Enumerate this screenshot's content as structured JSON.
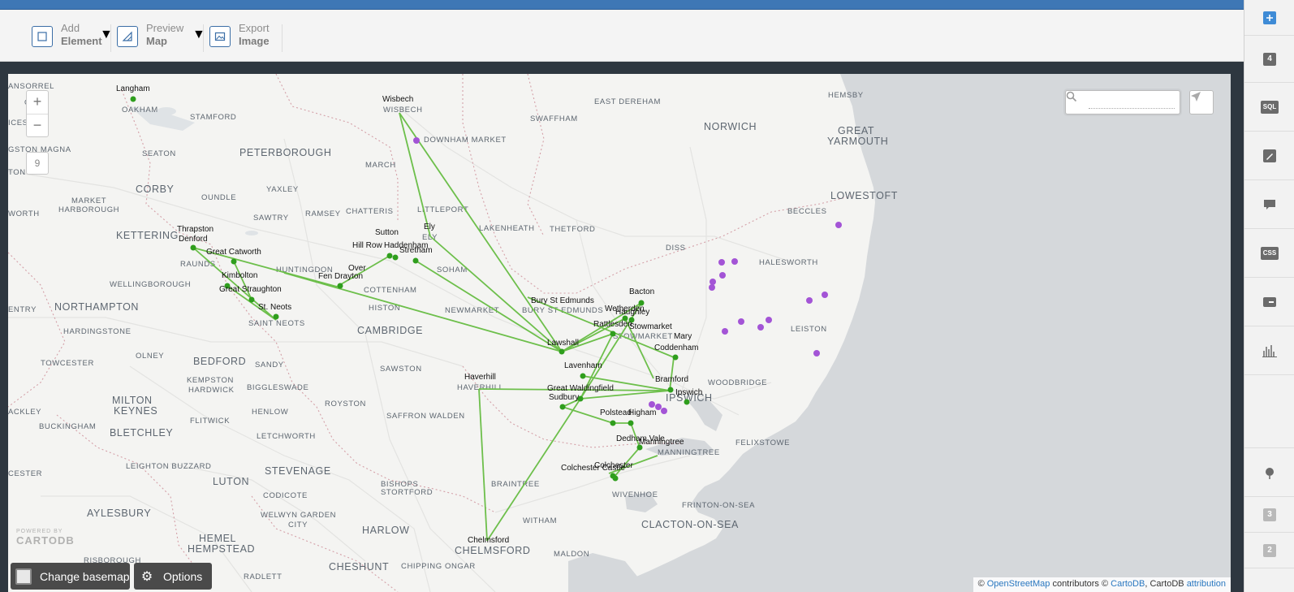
{
  "toolbar": {
    "add_element": {
      "line1": "Add",
      "line2": "Element"
    },
    "preview_map": {
      "line1": "Preview",
      "line2": "Map"
    },
    "export_image": {
      "line1": "Export",
      "line2": "Image"
    }
  },
  "sidebar": {
    "add_icon": "plus-icon",
    "layer_count": "4",
    "sql_label": "SQL",
    "css_label": "CSS",
    "bottom_badges": [
      "3",
      "2"
    ]
  },
  "map": {
    "zoom_in": "+",
    "zoom_out": "−",
    "zoom_level": "9",
    "search_placeholder": "",
    "change_basemap": "Change basemap",
    "options": "Options",
    "logo_powered": "POWERED BY",
    "logo_name": "CARTODB",
    "attribution": {
      "prefix": "© ",
      "osm": "OpenStreetMap",
      "mid": " contributors © ",
      "cartodb": "CartoDB",
      "mid2": ", CartoDB ",
      "attr": "attribution"
    },
    "colors": {
      "land": "#f4f4f2",
      "sea": "#d5d8db",
      "route": "#6dbf4b",
      "point_green": "#2f9e1d",
      "point_purple": "#a354d6"
    },
    "basemap_labels": [
      {
        "t": "NORWICH",
        "cls": "big"
      },
      {
        "t": "GREAT",
        "cls": "big"
      },
      {
        "t": "YARMOUTH",
        "cls": "big"
      },
      {
        "t": "LOWESTOFT",
        "cls": "big"
      },
      {
        "t": "PETERBOROUGH",
        "cls": "big"
      },
      {
        "t": "KETTERING",
        "cls": "big"
      },
      {
        "t": "CORBY",
        "cls": "big"
      },
      {
        "t": "NORTHAMPTON",
        "cls": "big"
      },
      {
        "t": "CAMBRIDGE",
        "cls": "big"
      },
      {
        "t": "BEDFORD",
        "cls": "big"
      },
      {
        "t": "MILTON",
        "cls": "big"
      },
      {
        "t": "KEYNES",
        "cls": "big"
      },
      {
        "t": "BLETCHLEY",
        "cls": "big"
      },
      {
        "t": "LUTON",
        "cls": "big"
      },
      {
        "t": "STEVENAGE",
        "cls": "big"
      },
      {
        "t": "AYLESBURY",
        "cls": "big"
      },
      {
        "t": "HEMEL",
        "cls": "big"
      },
      {
        "t": "HEMPSTEAD",
        "cls": "big"
      },
      {
        "t": "HARLOW",
        "cls": "big"
      },
      {
        "t": "CHELMSFORD",
        "cls": "big"
      },
      {
        "t": "CHESHUNT",
        "cls": "big"
      },
      {
        "t": "IPSWICH",
        "cls": "big"
      },
      {
        "t": "CLACTON-ON-SEA",
        "cls": "big"
      },
      {
        "t": "OAKHAM",
        "cls": "sm"
      },
      {
        "t": "STAMFORD",
        "cls": "sm"
      },
      {
        "t": "SEATON",
        "cls": "sm"
      },
      {
        "t": "WISBECH",
        "cls": "sm"
      },
      {
        "t": "DOWNHAM MARKET",
        "cls": "sm"
      },
      {
        "t": "SWAFFHAM",
        "cls": "sm"
      },
      {
        "t": "EAST DEREHAM",
        "cls": "sm"
      },
      {
        "t": "HEMSBY",
        "cls": "sm"
      },
      {
        "t": "MARCH",
        "cls": "sm"
      },
      {
        "t": "YAXLEY",
        "cls": "sm"
      },
      {
        "t": "OUNDLE",
        "cls": "sm"
      },
      {
        "t": "MARKET",
        "cls": "sm"
      },
      {
        "t": "HARBOROUGH",
        "cls": "sm"
      },
      {
        "t": "SAWTRY",
        "cls": "sm"
      },
      {
        "t": "RAMSEY",
        "cls": "sm"
      },
      {
        "t": "CHATTERIS",
        "cls": "sm"
      },
      {
        "t": "LITTLEPORT",
        "cls": "sm"
      },
      {
        "t": "ELY",
        "cls": "sm"
      },
      {
        "t": "LAKENHEATH",
        "cls": "sm"
      },
      {
        "t": "THETFORD",
        "cls": "sm"
      },
      {
        "t": "DISS",
        "cls": "sm"
      },
      {
        "t": "BECCLES",
        "cls": "sm"
      },
      {
        "t": "HALESWORTH",
        "cls": "sm"
      },
      {
        "t": "RAUNDS",
        "cls": "sm"
      },
      {
        "t": "HUNTINGDON",
        "cls": "sm"
      },
      {
        "t": "SOHAM",
        "cls": "sm"
      },
      {
        "t": "WELLINGBOROUGH",
        "cls": "sm"
      },
      {
        "t": "COTTENHAM",
        "cls": "sm"
      },
      {
        "t": "HISTON",
        "cls": "sm"
      },
      {
        "t": "NEWMARKET",
        "cls": "sm"
      },
      {
        "t": "BURY ST EDMUNDS",
        "cls": "sm"
      },
      {
        "t": "STOWMARKET",
        "cls": "sm"
      },
      {
        "t": "LEISTON",
        "cls": "sm"
      },
      {
        "t": "HARDINGSTONE",
        "cls": "sm"
      },
      {
        "t": "SAINT NEOTS",
        "cls": "sm"
      },
      {
        "t": "OLNEY",
        "cls": "sm"
      },
      {
        "t": "SANDY",
        "cls": "sm"
      },
      {
        "t": "SAWSTON",
        "cls": "sm"
      },
      {
        "t": "TOWCESTER",
        "cls": "sm"
      },
      {
        "t": "KEMPSTON",
        "cls": "sm"
      },
      {
        "t": "HARDWICK",
        "cls": "sm"
      },
      {
        "t": "BIGGLESWADE",
        "cls": "sm"
      },
      {
        "t": "HAVERHILL",
        "cls": "sm"
      },
      {
        "t": "WOODBRIDGE",
        "cls": "sm"
      },
      {
        "t": "ROYSTON",
        "cls": "sm"
      },
      {
        "t": "HENLOW",
        "cls": "sm"
      },
      {
        "t": "SAFFRON WALDEN",
        "cls": "sm"
      },
      {
        "t": "BUCKINGHAM",
        "cls": "sm"
      },
      {
        "t": "FLITWICK",
        "cls": "sm"
      },
      {
        "t": "LETCHWORTH",
        "cls": "sm"
      },
      {
        "t": "FELIXSTOWE",
        "cls": "sm"
      },
      {
        "t": "MANNINGTREE",
        "cls": "sm"
      },
      {
        "t": "LEIGHTON BUZZARD",
        "cls": "sm"
      },
      {
        "t": "BRAINTREE",
        "cls": "sm"
      },
      {
        "t": "CODICOTE",
        "cls": "sm"
      },
      {
        "t": "WIVENHOE",
        "cls": "sm"
      },
      {
        "t": "BISHOPS",
        "cls": "sm"
      },
      {
        "t": "STORTFORD",
        "cls": "sm"
      },
      {
        "t": "WELWYN GARDEN",
        "cls": "sm"
      },
      {
        "t": "CITY",
        "cls": "sm"
      },
      {
        "t": "WITHAM",
        "cls": "sm"
      },
      {
        "t": "FRINTON-ON-SEA",
        "cls": "sm"
      },
      {
        "t": "RISBOROUGH",
        "cls": "sm"
      },
      {
        "t": "CHIPPING ONGAR",
        "cls": "sm"
      },
      {
        "t": "MALDON",
        "cls": "sm"
      },
      {
        "t": "RADLETT",
        "cls": "sm"
      },
      {
        "t": "ICESTER",
        "cls": "sm"
      },
      {
        "t": "GSTON MAGNA",
        "cls": "sm"
      },
      {
        "t": "TON",
        "cls": "sm"
      },
      {
        "t": "WORTH",
        "cls": "sm"
      },
      {
        "t": "ENTRY",
        "cls": "sm"
      },
      {
        "t": "ACKLEY",
        "cls": "sm"
      },
      {
        "t": "CESTER",
        "cls": "sm"
      },
      {
        "t": "ANSORREL",
        "cls": "sm"
      },
      {
        "t": "ON",
        "cls": "sm"
      }
    ],
    "places": [
      "Langham",
      "Wisbech",
      "Thrapston",
      "Denford",
      "Great Catworth",
      "Kimbolton",
      "Great Straughton",
      "St. Neots",
      "Sutton",
      "Hill Row",
      "Haddenham",
      "Stretham",
      "Ely",
      "Over",
      "Fen Drayton",
      "Bury St Edmunds",
      "Bacton",
      "Wetherden",
      "Haughley",
      "Stowmarket",
      "Rattlesden",
      "Lawshall",
      "Mary",
      "Coddenham",
      "Lavenham",
      "Haverhill",
      "Great Waldingfield",
      "Sudbury",
      "Bramford",
      "Ipswich",
      "Polstead",
      "Higham",
      "Dedham Vale",
      "Manningtree",
      "Colchester",
      "Colchester Castle",
      "Chelmsford"
    ]
  }
}
